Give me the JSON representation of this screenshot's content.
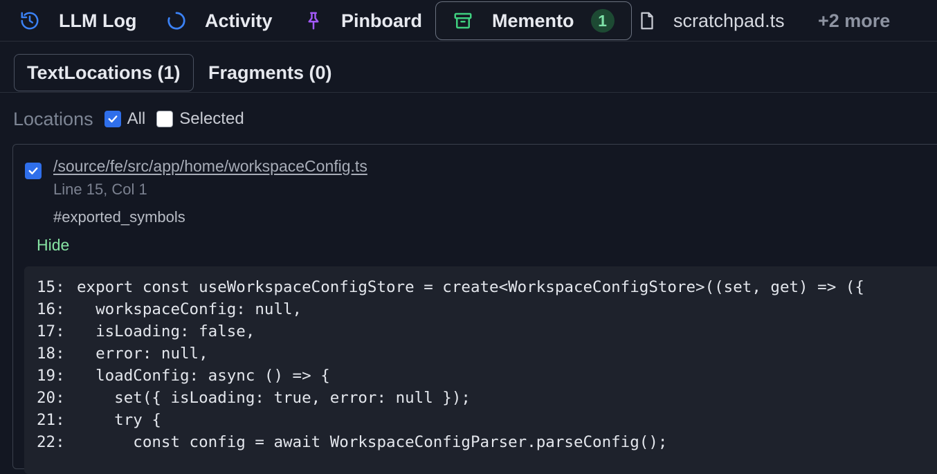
{
  "tabs": [
    {
      "label": "LLM Log",
      "icon": "history-icon"
    },
    {
      "label": "Activity",
      "icon": "spinner-icon"
    },
    {
      "label": "Pinboard",
      "icon": "pin-icon"
    },
    {
      "label": "Memento",
      "icon": "archive-icon",
      "badge": "1",
      "active": true
    },
    {
      "label": "scratchpad.ts",
      "icon": "file-icon"
    },
    {
      "label": "+2 more"
    }
  ],
  "subtabs": [
    {
      "label": "TextLocations (1)",
      "active": true
    },
    {
      "label": "Fragments (0)"
    }
  ],
  "filters": {
    "label": "Locations",
    "options": [
      {
        "label": "All",
        "checked": true
      },
      {
        "label": "Selected",
        "checked": false
      }
    ]
  },
  "location": {
    "checked": true,
    "path": "/source/fe/src/app/home/workspaceConfig.ts",
    "position": "Line 15, Col 1",
    "symbol": "#exported_symbols",
    "toggle_label": "Hide"
  },
  "code": [
    {
      "n": "15:",
      "text": "export const useWorkspaceConfigStore = create<WorkspaceConfigStore>((set, get) => ({"
    },
    {
      "n": "16:",
      "text": "  workspaceConfig: null,"
    },
    {
      "n": "17:",
      "text": "  isLoading: false,"
    },
    {
      "n": "18:",
      "text": "  error: null,"
    },
    {
      "n": "19:",
      "text": "  loadConfig: async () => {"
    },
    {
      "n": "20:",
      "text": "    set({ isLoading: true, error: null });"
    },
    {
      "n": "21:",
      "text": "    try {"
    },
    {
      "n": "22:",
      "text": "      const config = await WorkspaceConfigParser.parseConfig();"
    }
  ],
  "colors": {
    "accent": "#2f6feb",
    "badge_bg": "#1d4a33",
    "badge_fg": "#7ee2a8",
    "link_green": "#86e3a3",
    "pin_purple": "#a259f7",
    "archive_green": "#3fcf7f",
    "history_blue": "#3b82f6"
  }
}
